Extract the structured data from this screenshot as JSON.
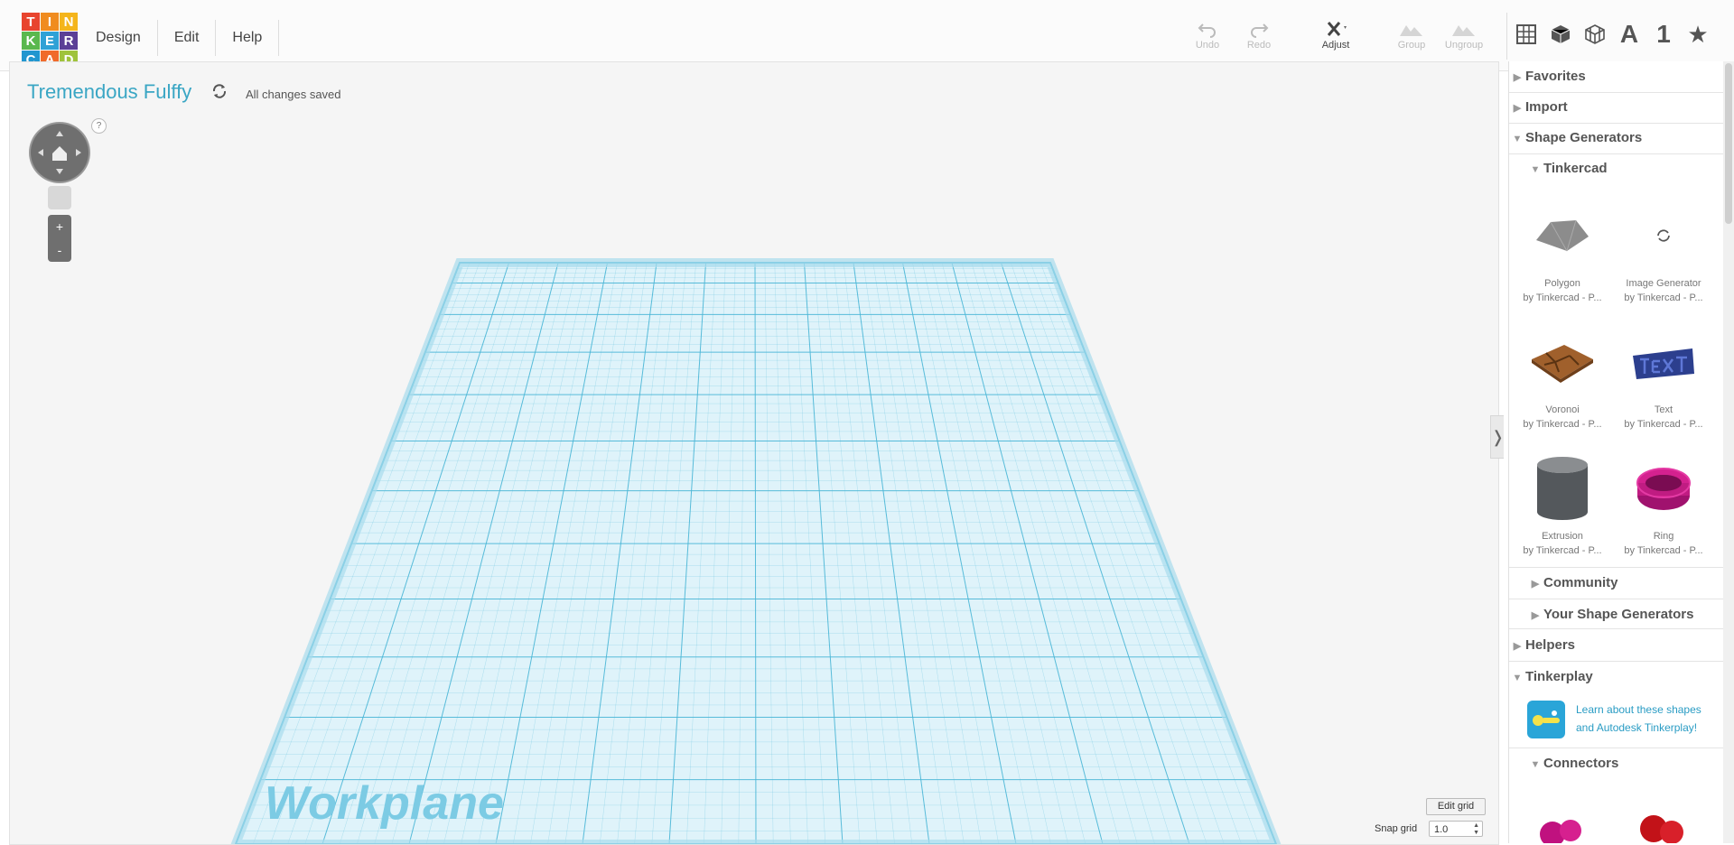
{
  "app": {
    "logo_letters": [
      "T",
      "I",
      "N",
      "K",
      "E",
      "R",
      "C",
      "A",
      "D"
    ],
    "logo_colors": [
      "#e8442e",
      "#f08c1f",
      "#f4b51b",
      "#5ab84e",
      "#2fa1d6",
      "#5b3f96",
      "#2196cf",
      "#f06a2a",
      "#9fc33b"
    ]
  },
  "menu": {
    "design": "Design",
    "edit": "Edit",
    "help": "Help"
  },
  "toolbar": {
    "undo": "Undo",
    "redo": "Redo",
    "adjust": "Adjust",
    "group": "Group",
    "ungroup": "Ungroup",
    "view_text_icon": "A",
    "view_number_icon": "1"
  },
  "document": {
    "title": "Tremendous Fulffy",
    "status": "All changes saved"
  },
  "workplane": {
    "label": "Workplane",
    "edit_grid_label": "Edit grid",
    "snap_grid_label": "Snap grid",
    "snap_grid_value": "1.0",
    "help_mark": "?",
    "zoom_in": "+",
    "zoom_out": "-"
  },
  "sidebar": {
    "sections": {
      "favorites": "Favorites",
      "import": "Import",
      "shape_generators": "Shape Generators",
      "tinkercad": "Tinkercad",
      "community": "Community",
      "your_shape_generators": "Your Shape Generators",
      "helpers": "Helpers",
      "tinkerplay": "Tinkerplay",
      "connectors": "Connectors"
    },
    "shapes": [
      {
        "name": "Polygon",
        "by": "by Tinkercad - P..."
      },
      {
        "name": "Image Generator",
        "by": "by Tinkercad - P..."
      },
      {
        "name": "Voronoi",
        "by": "by Tinkercad - P..."
      },
      {
        "name": "Text",
        "by": "by Tinkercad - P..."
      },
      {
        "name": "Extrusion",
        "by": "by Tinkercad - P..."
      },
      {
        "name": "Ring",
        "by": "by Tinkercad - P..."
      }
    ],
    "tinkerplay_link_line1": "Learn about these shapes",
    "tinkerplay_link_line2": "and Autodesk Tinkerplay!",
    "collapse_glyph": "❭"
  },
  "colors": {
    "accent": "#3aa6c4",
    "grid_line": "#49b6d6",
    "grid_fill": "#dff3fa"
  }
}
